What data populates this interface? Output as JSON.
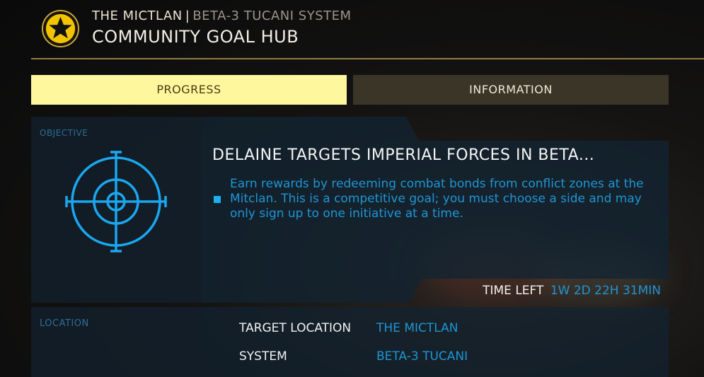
{
  "header": {
    "station": "THE MICTLAN",
    "separator": "|",
    "system": "BETA-3 TUCANI SYSTEM",
    "title": "COMMUNITY GOAL HUB",
    "emblem_icon": "star-emblem-icon"
  },
  "tabs": [
    {
      "label": "PROGRESS",
      "active": true
    },
    {
      "label": "INFORMATION",
      "active": false
    }
  ],
  "objective": {
    "section_label": "OBJECTIVE",
    "icon": "crosshair-target-icon",
    "title": "DELAINE TARGETS IMPERIAL FORCES IN BETA...",
    "description": "Earn rewards by redeeming combat bonds from conflict zones at the Mitclan. This is a competitive goal; you must choose a side and may only sign up to one initiative at a time.",
    "time_left_label": "TIME LEFT",
    "time_left_value": "1W 2D 22H 31MIN"
  },
  "location": {
    "section_label": "LOCATION",
    "rows": [
      {
        "key": "TARGET LOCATION",
        "value": "THE MICTLAN"
      },
      {
        "key": "SYSTEM",
        "value": "BETA-3 TUCANI"
      }
    ]
  },
  "colors": {
    "accent_yellow": "#fff79e",
    "accent_blue": "#1f95d4",
    "divider_gold": "#8f7d48",
    "tab_inactive": "#3b3527",
    "panel_dark": "#12202c"
  }
}
